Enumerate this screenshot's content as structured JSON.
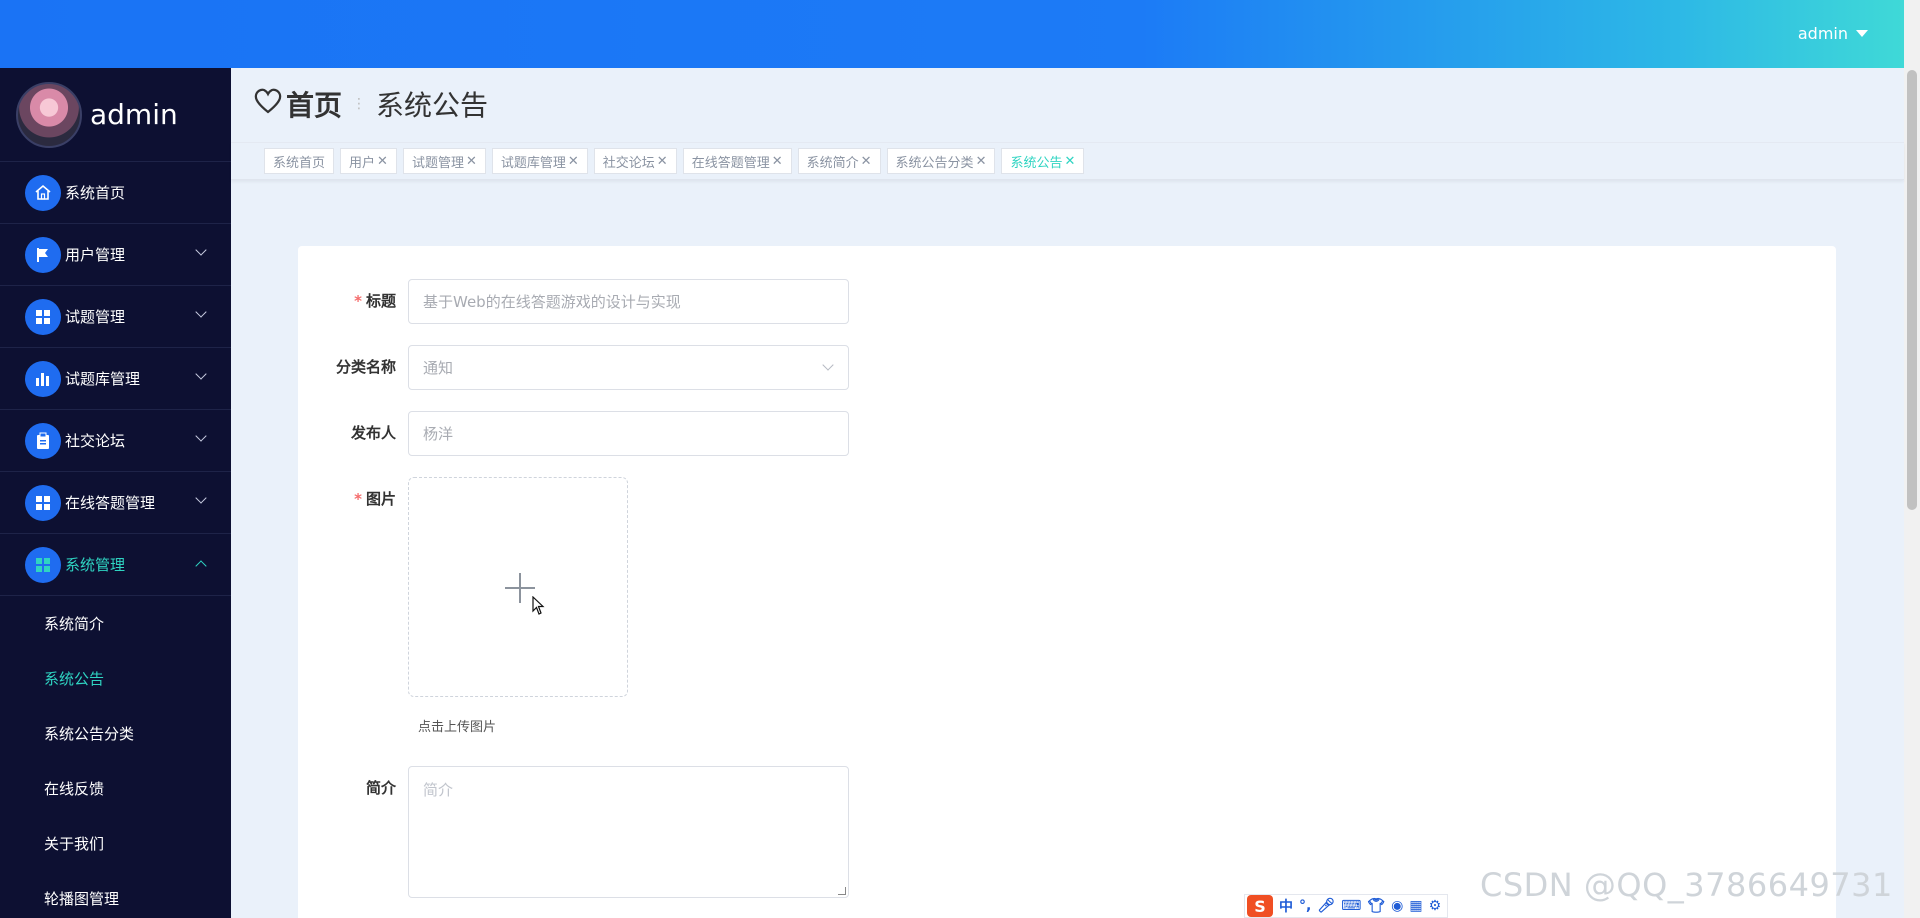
{
  "header": {
    "user_label": "admin"
  },
  "sidebar": {
    "profile_name": "admin",
    "menu": [
      {
        "label": "系统首页",
        "icon": "home-icon"
      },
      {
        "label": "用户管理",
        "icon": "flag-icon"
      },
      {
        "label": "试题管理",
        "icon": "grid-icon"
      },
      {
        "label": "试题库管理",
        "icon": "bar-chart-icon"
      },
      {
        "label": "社交论坛",
        "icon": "clipboard-icon"
      },
      {
        "label": "在线答题管理",
        "icon": "grid-icon"
      },
      {
        "label": "系统管理",
        "icon": "grid-icon"
      }
    ],
    "submenu": [
      "系统简介",
      "系统公告",
      "系统公告分类",
      "在线反馈",
      "关于我们",
      "轮播图管理"
    ]
  },
  "breadcrumb": {
    "home": "首页",
    "current": "系统公告"
  },
  "tags": [
    {
      "label": "系统首页",
      "closable": false
    },
    {
      "label": "用户",
      "closable": true
    },
    {
      "label": "试题管理",
      "closable": true
    },
    {
      "label": "试题库管理",
      "closable": true
    },
    {
      "label": "社交论坛",
      "closable": true
    },
    {
      "label": "在线答题管理",
      "closable": true
    },
    {
      "label": "系统简介",
      "closable": true
    },
    {
      "label": "系统公告分类",
      "closable": true
    },
    {
      "label": "系统公告",
      "closable": true
    }
  ],
  "form": {
    "title_label": "标题",
    "title_value": "基于Web的在线答题游戏的设计与实现",
    "category_label": "分类名称",
    "category_value": "通知",
    "publisher_label": "发布人",
    "publisher_value": "杨洋",
    "image_label": "图片",
    "upload_hint": "点击上传图片",
    "intro_label": "简介",
    "intro_placeholder": "简介",
    "required_mark": "*"
  },
  "ime": {
    "logo": "S",
    "mode": "中",
    "punct": "°,"
  },
  "watermark": "CSDN @QQ_3786649731",
  "colors": {
    "accent": "#2fd4c2",
    "primary": "#1f6cf0",
    "sidebar_bg": "#0d1032"
  }
}
